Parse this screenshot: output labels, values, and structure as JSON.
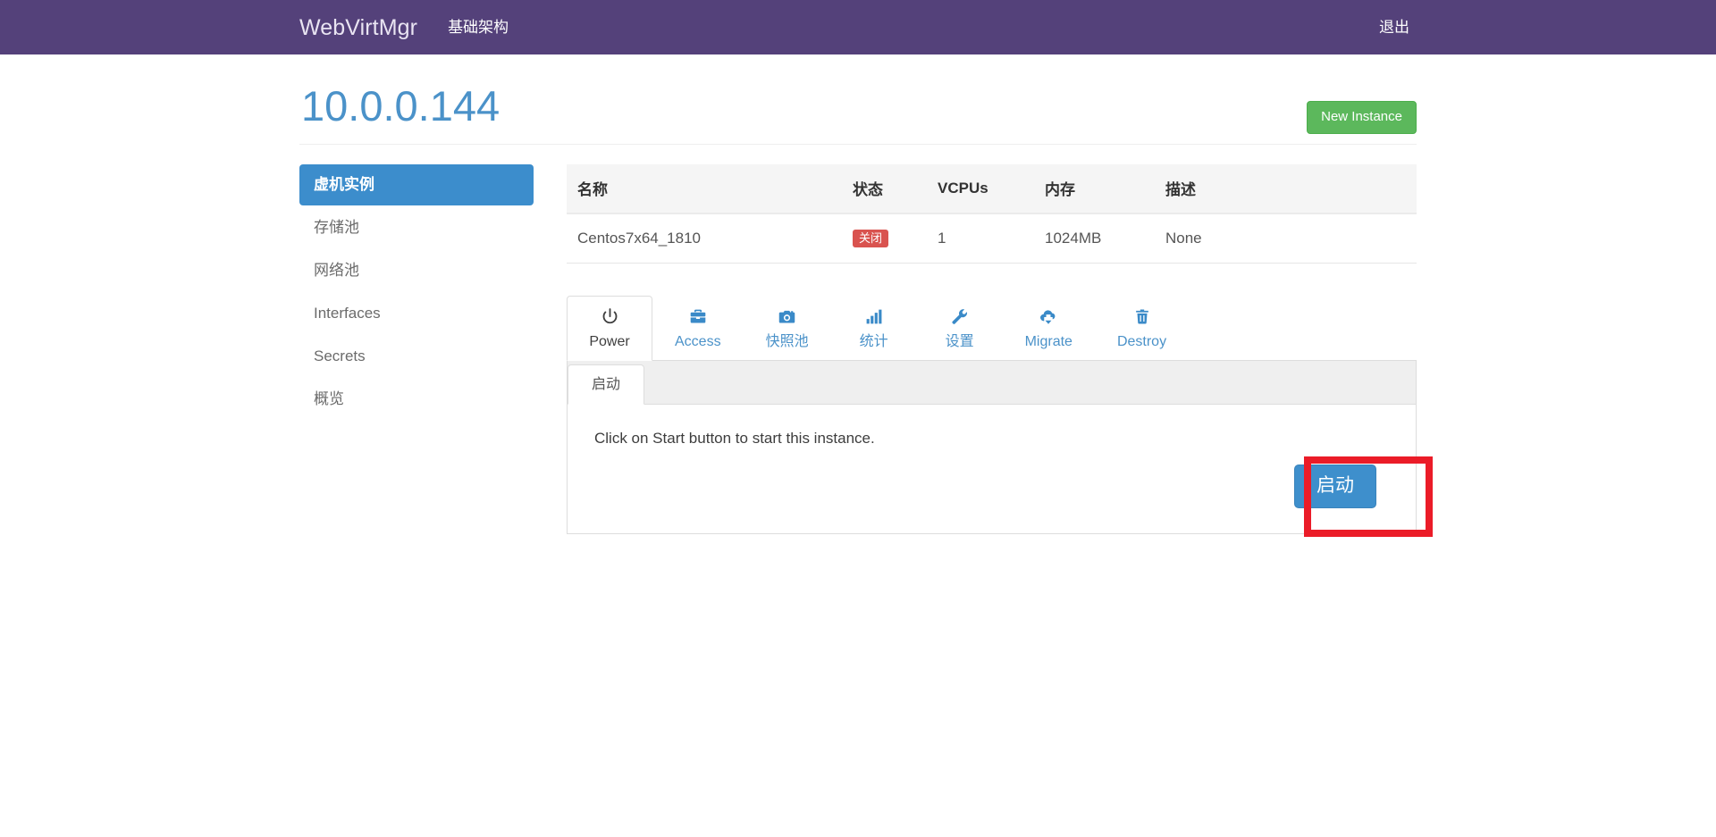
{
  "navbar": {
    "brand": "WebVirtMgr",
    "links": [
      {
        "label": "基础架构",
        "name": "nav-link-infrastructure"
      }
    ],
    "logout_label": "退出",
    "background_color": "#54417a"
  },
  "page": {
    "title": "10.0.0.144",
    "title_color": "#4b92c9",
    "new_instance_label": "New Instance",
    "new_instance_color": "#5cb85c"
  },
  "sidebar": {
    "items": [
      {
        "label": "虚机实例",
        "active": true
      },
      {
        "label": "存储池",
        "active": false
      },
      {
        "label": "网络池",
        "active": false
      },
      {
        "label": "Interfaces",
        "active": false
      },
      {
        "label": "Secrets",
        "active": false
      },
      {
        "label": "概览",
        "active": false
      }
    ],
    "active_color": "#3c8dcc"
  },
  "instances_table": {
    "headers": [
      "名称",
      "状态",
      "VCPUs",
      "内存",
      "描述"
    ],
    "rows": [
      {
        "name": "Centos7x64_1810",
        "state": "关闭",
        "state_color": "#d9534f",
        "vcpus": "1",
        "memory": "1024MB",
        "description": "None"
      }
    ]
  },
  "tabs": [
    {
      "label": "Power",
      "icon": "power-off-icon",
      "active": true
    },
    {
      "label": "Access",
      "icon": "briefcase-icon",
      "active": false
    },
    {
      "label": "快照池",
      "icon": "camera-icon",
      "active": false
    },
    {
      "label": "统计",
      "icon": "bar-chart-icon",
      "active": false
    },
    {
      "label": "设置",
      "icon": "wrench-icon",
      "active": false
    },
    {
      "label": "Migrate",
      "icon": "cloud-download-icon",
      "active": false
    },
    {
      "label": "Destroy",
      "icon": "trash-icon",
      "active": false
    }
  ],
  "power_pane": {
    "inner_tab_label": "启动",
    "message": "Click on Start button to start this instance.",
    "start_button_label": "启动",
    "start_button_color": "#3e8fcc"
  },
  "annotation": {
    "color": "#eb1c28"
  }
}
